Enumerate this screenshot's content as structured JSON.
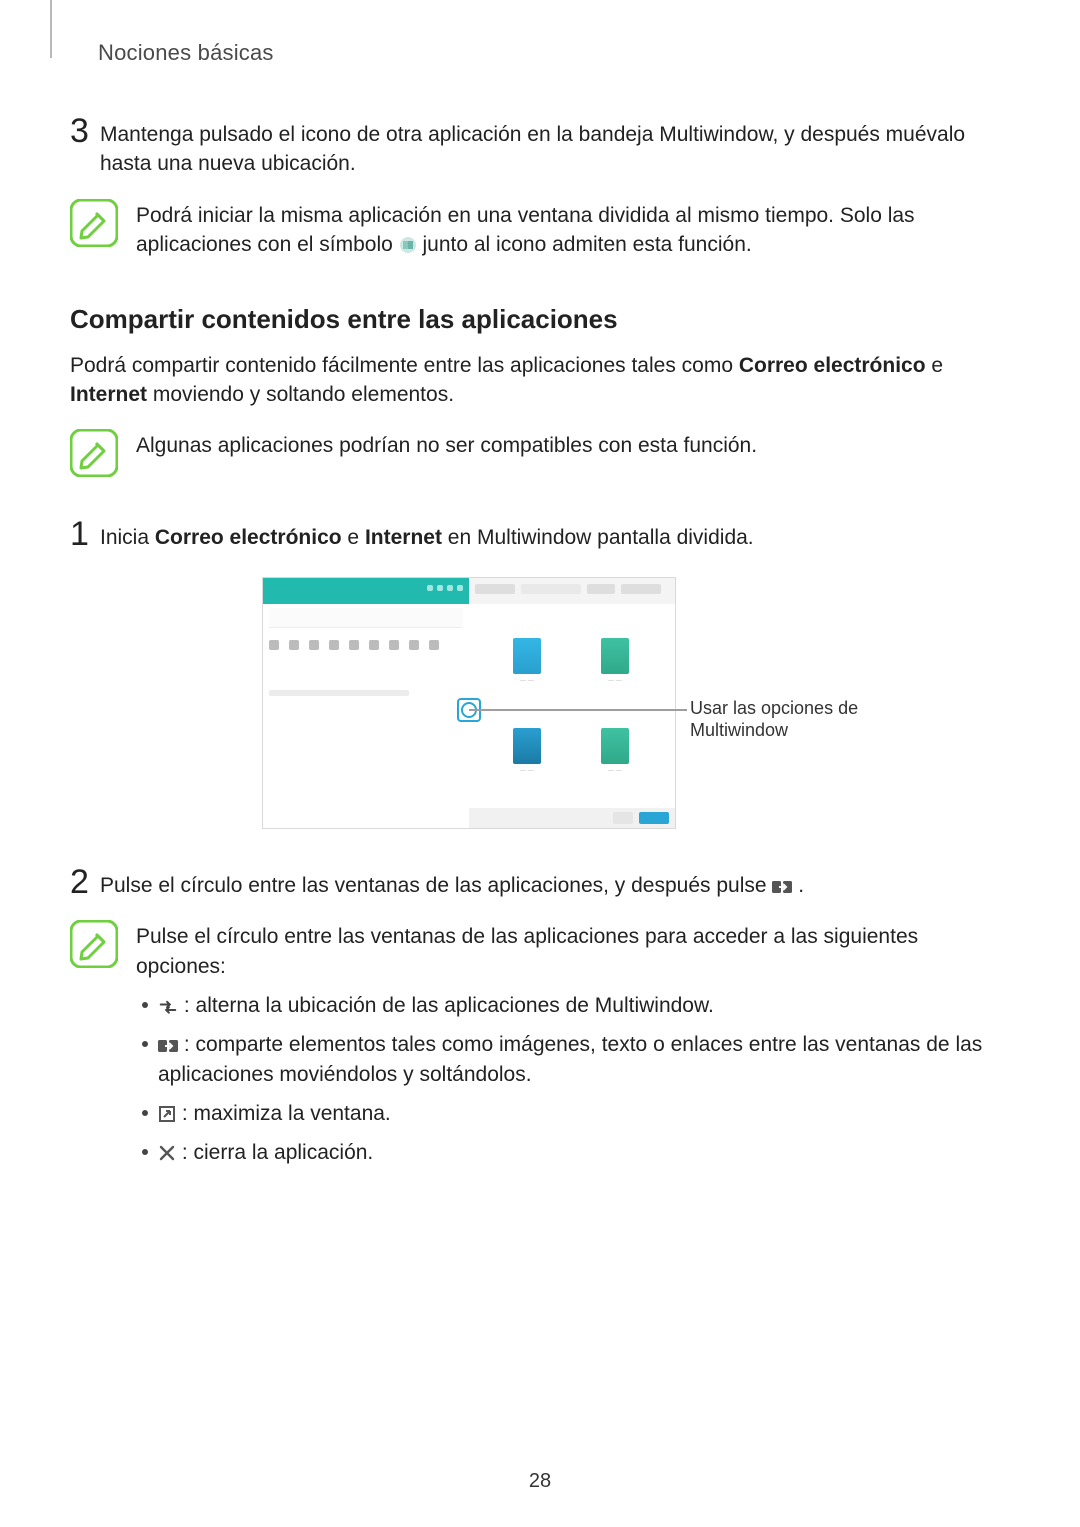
{
  "header": {
    "section_title": "Nociones básicas"
  },
  "step3": {
    "num": "3",
    "text": "Mantenga pulsado el icono de otra aplicación en la bandeja Multiwindow, y después muévalo hasta una nueva ubicación."
  },
  "note1": {
    "pre": "Podrá iniciar la misma aplicación en una ventana dividida al mismo tiempo. Solo las aplicaciones con el símbolo ",
    "post": " junto al icono admiten esta función."
  },
  "section_heading": "Compartir contenidos entre las aplicaciones",
  "share_para": {
    "t1": "Podrá compartir contenido fácilmente entre las aplicaciones tales como ",
    "b1": "Correo electrónico",
    "t2": " e ",
    "b2": "Internet",
    "t3": " moviendo y soltando elementos."
  },
  "note2": {
    "text": "Algunas aplicaciones podrían no ser compatibles con esta función."
  },
  "step1": {
    "num": "1",
    "t1": "Inicia ",
    "b1": "Correo electrónico",
    "t2": " e ",
    "b2": "Internet",
    "t3": " en Multiwindow pantalla dividida."
  },
  "figure_callout": "Usar las opciones de Multiwindow",
  "step2": {
    "num": "2",
    "t1": "Pulse el círculo entre las ventanas de las aplicaciones, y después pulse ",
    "t2": "."
  },
  "note3_intro": "Pulse el círculo entre las ventanas de las aplicaciones para acceder a las siguientes opciones:",
  "bullets": {
    "swap": " : alterna la ubicación de las aplicaciones de Multiwindow.",
    "share": " : comparte elementos tales como imágenes, texto o enlaces entre las ventanas de las aplicaciones moviéndolos y soltándolos.",
    "max": " : maximiza la ventana.",
    "close": " : cierra la aplicación."
  },
  "page_number": "28",
  "icons": {
    "dual": "dual-window-icon",
    "share": "drag-share-icon",
    "swap": "swap-icon",
    "max": "maximize-icon",
    "close": "close-icon",
    "note": "note-pencil-icon"
  }
}
